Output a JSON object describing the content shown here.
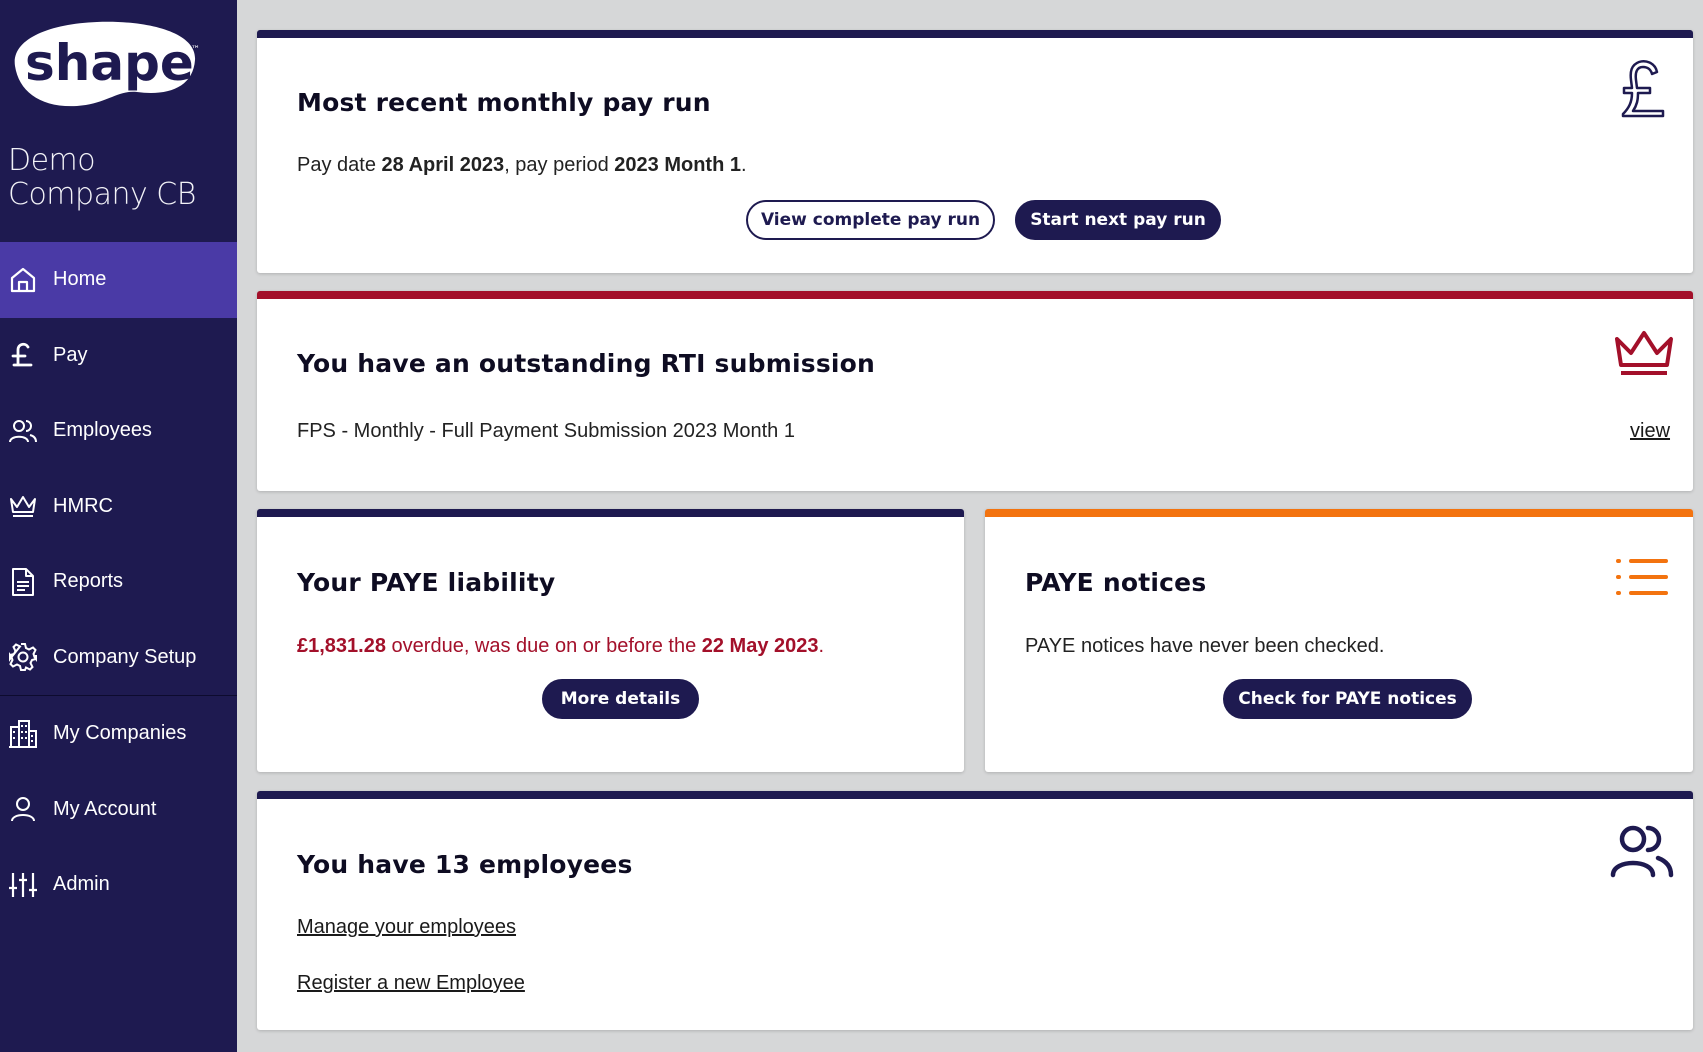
{
  "brand": {
    "logo_text": "shape",
    "logo_mark": "™",
    "company_name": "Demo Company CB"
  },
  "nav": {
    "items": [
      {
        "label": "Home",
        "icon": "home-icon",
        "active": true
      },
      {
        "label": "Pay",
        "icon": "pound-icon"
      },
      {
        "label": "Employees",
        "icon": "users-icon"
      },
      {
        "label": "HMRC",
        "icon": "crown-icon"
      },
      {
        "label": "Reports",
        "icon": "document-icon"
      },
      {
        "label": "Company Setup",
        "icon": "gear-icon"
      },
      {
        "label": "My Companies",
        "icon": "building-icon"
      },
      {
        "label": "My Account",
        "icon": "user-icon"
      },
      {
        "label": "Admin",
        "icon": "sliders-icon"
      }
    ]
  },
  "payrun": {
    "title": "Most recent monthly pay run",
    "pay_date_prefix": "Pay date ",
    "pay_date": "28 April 2023",
    "period_prefix": ", pay period ",
    "period": "2023 Month 1",
    "suffix": ".",
    "view_button": "View complete pay run",
    "start_button": "Start next pay run",
    "icon": "pound-icon"
  },
  "rti": {
    "title": "You have an outstanding RTI submission",
    "submission": "FPS - Monthly - Full Payment Submission 2023 Month 1",
    "view_link": "view",
    "icon": "crown-icon",
    "accent_color": "#a3102a"
  },
  "paye": {
    "title": "Your PAYE liability",
    "amount": "£1,831.28",
    "middle": " overdue, was due on or before the ",
    "due_date": "22 May 2023",
    "suffix": ".",
    "button": "More details"
  },
  "notices": {
    "title": "PAYE notices",
    "text": "PAYE notices have never been checked.",
    "button": "Check for PAYE notices",
    "icon": "list-icon",
    "accent_color": "#f3730f"
  },
  "employees": {
    "title": "You have 13 employees",
    "manage_link": "Manage your employees",
    "register_link": "Register a new Employee",
    "icon": "users-icon"
  },
  "colors": {
    "sidebar": "#1e1a50",
    "active": "#4a3aa6",
    "background": "#d6d7d8"
  }
}
